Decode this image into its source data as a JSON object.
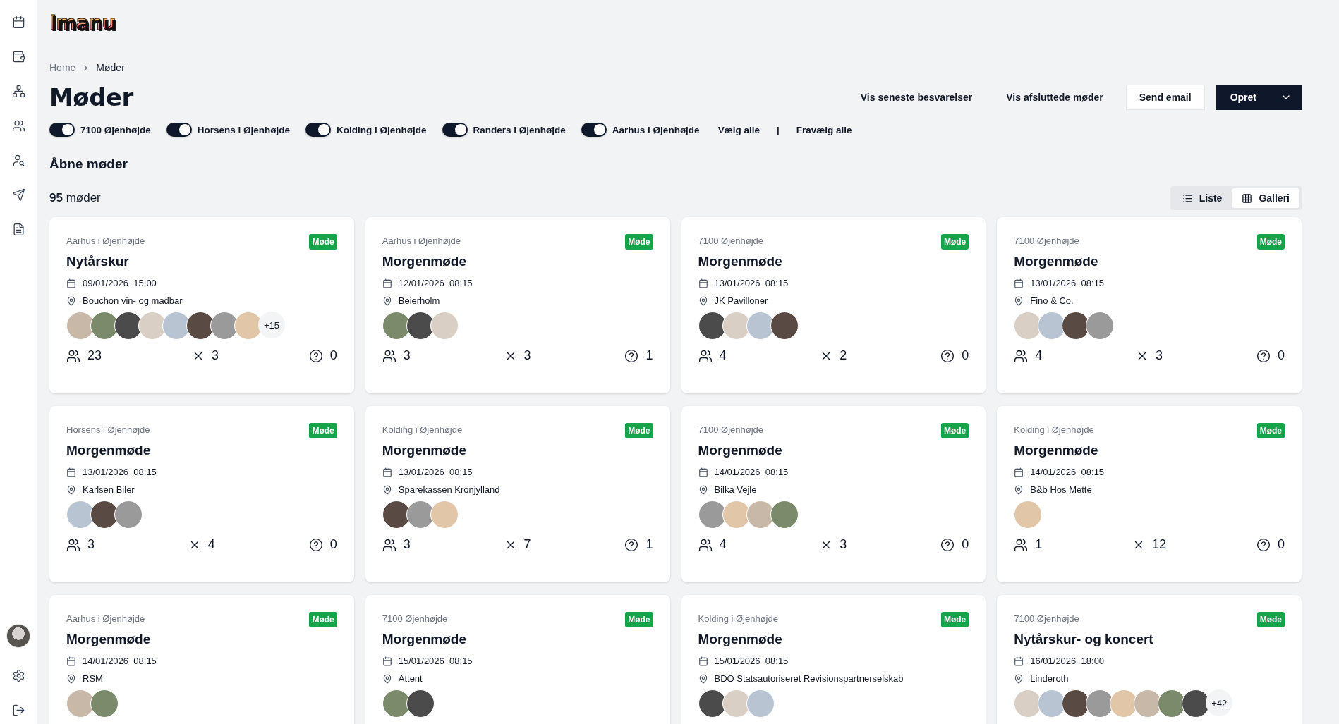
{
  "logo": "Imanu",
  "breadcrumb": [
    "Home",
    "Møder"
  ],
  "title": "Møder",
  "actions": [
    {
      "label": "Vis seneste besvarelser",
      "kind": "link"
    },
    {
      "label": "Vis afsluttede møder",
      "kind": "link"
    },
    {
      "label": "Send email",
      "kind": "outline"
    },
    {
      "label": "Opret",
      "kind": "primary"
    }
  ],
  "filters": [
    {
      "label": "7100 Øjenhøjde",
      "checked": true
    },
    {
      "label": "Horsens i Øjenhøjde",
      "checked": true
    },
    {
      "label": "Kolding i Øjenhøjde",
      "checked": true
    },
    {
      "label": "Randers i Øjenhøjde",
      "checked": true
    },
    {
      "label": "Aarhus i Øjenhøjde",
      "checked": true
    }
  ],
  "select_all": "Vælg alle",
  "separator": "|",
  "deselect_all": "Fravælg alle",
  "section_title": "Åbne møder",
  "count": {
    "number": "95",
    "label": "møder"
  },
  "view_modes": [
    {
      "label": "Liste",
      "kind": "list",
      "selected": false
    },
    {
      "label": "Galleri",
      "kind": "grid",
      "selected": true
    }
  ],
  "meetings": [
    {
      "group": "Aarhus i Øjenhøjde",
      "badge": "Møde",
      "title": "Nytårskur",
      "date": "09/01/2026",
      "time": "15:00",
      "location": "Bouchon vin- og madbar",
      "avatars": [
        {
          "kind": "photo"
        },
        {
          "kind": "photo"
        },
        {
          "kind": "photo"
        },
        {
          "kind": "photo"
        },
        {
          "kind": "photo"
        },
        {
          "kind": "photo"
        },
        {
          "kind": "photo"
        },
        {
          "kind": "photo"
        }
      ],
      "more": "+15",
      "attending": "23",
      "declined": "3",
      "unknown": "0"
    },
    {
      "group": "Aarhus i Øjenhøjde",
      "badge": "Møde",
      "title": "Morgenmøde",
      "date": "12/01/2026",
      "time": "08:15",
      "location": "Beierholm",
      "avatars": [
        {
          "kind": "photo"
        },
        {
          "kind": "photo"
        },
        {
          "kind": "photo"
        }
      ],
      "attending": "3",
      "declined": "3",
      "unknown": "1"
    },
    {
      "group": "7100 Øjenhøjde",
      "badge": "Møde",
      "title": "Morgenmøde",
      "date": "13/01/2026",
      "time": "08:15",
      "location": "JK Pavilloner",
      "avatars": [
        {
          "kind": "photo"
        },
        {
          "kind": "photo"
        },
        {
          "kind": "photo"
        },
        {
          "kind": "photo"
        }
      ],
      "attending": "4",
      "declined": "2",
      "unknown": "0"
    },
    {
      "group": "7100 Øjenhøjde",
      "badge": "Møde",
      "title": "Morgenmøde",
      "date": "13/01/2026",
      "time": "08:15",
      "location": "Fino & Co.",
      "avatars": [
        {
          "kind": "photo"
        },
        {
          "kind": "photo"
        },
        {
          "kind": "photo"
        },
        {
          "kind": "photo"
        }
      ],
      "attending": "4",
      "declined": "3",
      "unknown": "0"
    },
    {
      "group": "Horsens i Øjenhøjde",
      "badge": "Møde",
      "title": "Morgenmøde",
      "date": "13/01/2026",
      "time": "08:15",
      "location": "Karlsen Biler",
      "avatars": [
        {
          "kind": "photo"
        },
        {
          "kind": "photo"
        },
        {
          "kind": "photo"
        }
      ],
      "attending": "3",
      "declined": "4",
      "unknown": "0"
    },
    {
      "group": "Kolding i Øjenhøjde",
      "badge": "Møde",
      "title": "Morgenmøde",
      "date": "13/01/2026",
      "time": "08:15",
      "location": "Sparekassen Kronjylland",
      "avatars": [
        {
          "kind": "photo"
        },
        {
          "kind": "photo"
        },
        {
          "kind": "photo"
        }
      ],
      "attending": "3",
      "declined": "7",
      "unknown": "1"
    },
    {
      "group": "7100 Øjenhøjde",
      "badge": "Møde",
      "title": "Morgenmøde",
      "date": "14/01/2026",
      "time": "08:15",
      "location": "Bilka Vejle",
      "avatars": [
        {
          "kind": "photo"
        },
        {
          "kind": "photo"
        },
        {
          "kind": "photo"
        },
        {
          "kind": "photo"
        }
      ],
      "attending": "4",
      "declined": "3",
      "unknown": "0"
    },
    {
      "group": "Kolding i Øjenhøjde",
      "badge": "Møde",
      "title": "Morgenmøde",
      "date": "14/01/2026",
      "time": "08:15",
      "location": "B&b Hos Mette",
      "avatars": [
        {
          "kind": "photo"
        }
      ],
      "attending": "1",
      "declined": "12",
      "unknown": "0"
    },
    {
      "group": "Aarhus i Øjenhøjde",
      "badge": "Møde",
      "title": "Morgenmøde",
      "date": "14/01/2026",
      "time": "08:15",
      "location": "RSM",
      "avatars": [
        {
          "kind": "photo"
        },
        {
          "kind": "photo"
        }
      ]
    },
    {
      "group": "7100 Øjenhøjde",
      "badge": "Møde",
      "title": "Morgenmøde",
      "date": "15/01/2026",
      "time": "08:15",
      "location": "Attent",
      "avatars": [
        {
          "kind": "photo"
        },
        {
          "kind": "photo"
        }
      ]
    },
    {
      "group": "Kolding i Øjenhøjde",
      "badge": "Møde",
      "title": "Morgenmøde",
      "date": "15/01/2026",
      "time": "08:15",
      "location": "BDO Statsautoriseret Revisionspartnerselskab",
      "avatars": [
        {
          "kind": "photo"
        },
        {
          "kind": "photo"
        },
        {
          "kind": "photo"
        }
      ]
    },
    {
      "group": "7100 Øjenhøjde",
      "badge": "Møde",
      "title": "Nytårskur- og koncert",
      "date": "16/01/2026",
      "time": "18:00",
      "location": "Linderoth",
      "avatars": [
        {
          "kind": "photo"
        },
        {
          "kind": "photo"
        },
        {
          "kind": "photo"
        },
        {
          "kind": "photo"
        },
        {
          "kind": "photo"
        },
        {
          "kind": "photo"
        },
        {
          "kind": "photo"
        },
        {
          "kind": "photo"
        }
      ],
      "more": "+42"
    }
  ]
}
